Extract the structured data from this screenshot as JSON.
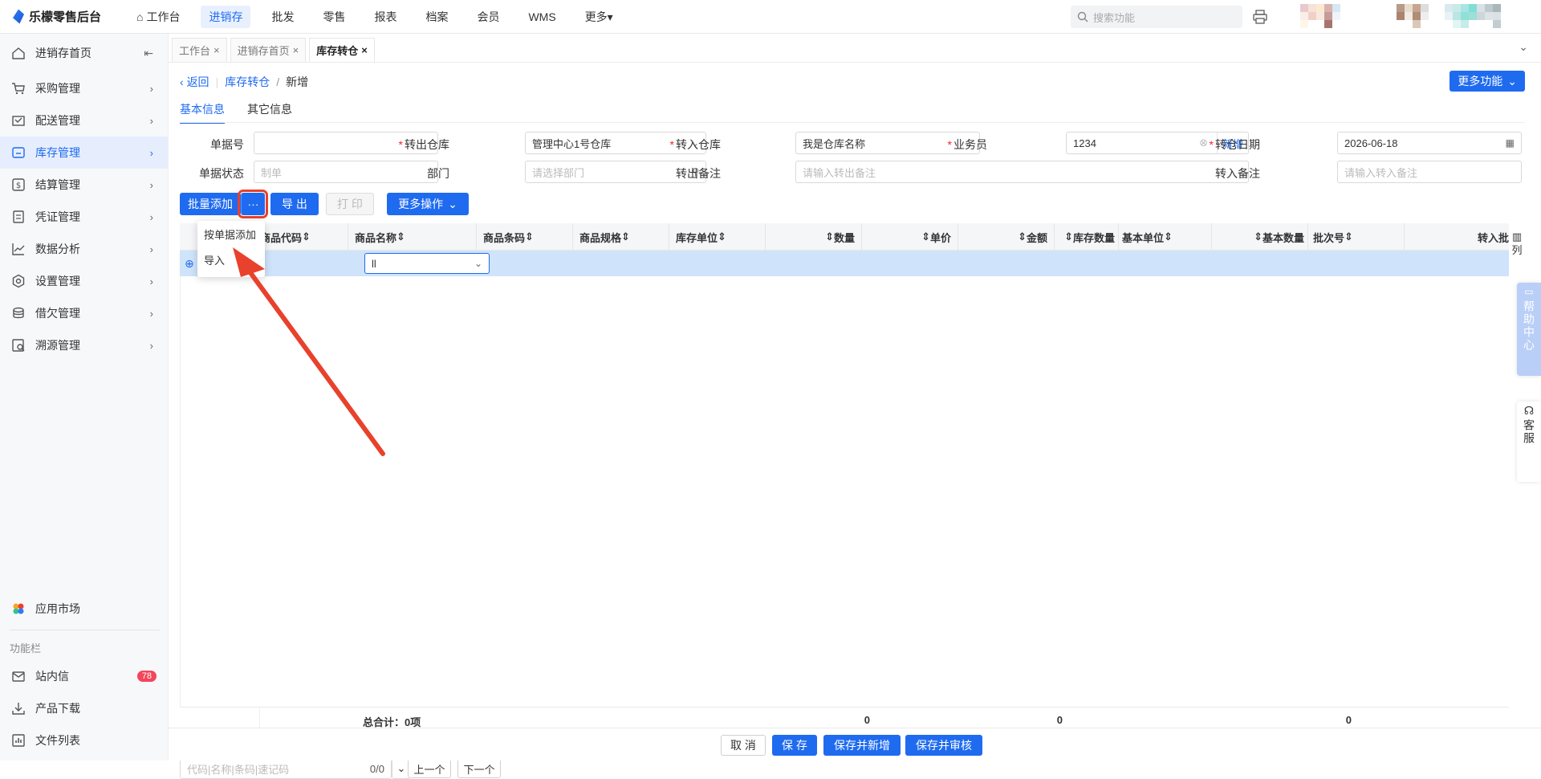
{
  "app": {
    "title": "乐檬零售后台"
  },
  "topnav": [
    {
      "label": "工作台",
      "icon": "home-icon"
    },
    {
      "label": "进销存",
      "active": true
    },
    {
      "label": "批发"
    },
    {
      "label": "零售"
    },
    {
      "label": "报表"
    },
    {
      "label": "档案"
    },
    {
      "label": "会员"
    },
    {
      "label": "WMS"
    },
    {
      "label": "更多▾"
    }
  ],
  "search": {
    "placeholder": "搜索功能"
  },
  "sidebar": {
    "items": [
      {
        "label": "进销存首页",
        "icon": "home-icon"
      },
      {
        "label": "采购管理",
        "icon": "cart-icon"
      },
      {
        "label": "配送管理",
        "icon": "truck-icon"
      },
      {
        "label": "库存管理",
        "icon": "inventory-icon",
        "active": true
      },
      {
        "label": "结算管理",
        "icon": "dollar-icon"
      },
      {
        "label": "凭证管理",
        "icon": "voucher-icon"
      },
      {
        "label": "数据分析",
        "icon": "chart-icon"
      },
      {
        "label": "设置管理",
        "icon": "settings-icon"
      },
      {
        "label": "借欠管理",
        "icon": "coins-icon"
      },
      {
        "label": "溯源管理",
        "icon": "trace-icon"
      }
    ],
    "market": "应用市场",
    "group_title": "功能栏",
    "footer": [
      {
        "label": "站内信",
        "badge": "78"
      },
      {
        "label": "产品下载"
      },
      {
        "label": "文件列表"
      }
    ]
  },
  "tabs": [
    {
      "label": "工作台"
    },
    {
      "label": "进销存首页"
    },
    {
      "label": "库存转仓",
      "active": true
    }
  ],
  "breadcrumb": {
    "back": "返回",
    "parent": "库存转仓",
    "sep": "/",
    "current": "新增"
  },
  "more_functions": "更多功能",
  "subtabs": [
    {
      "label": "基本信息",
      "active": true
    },
    {
      "label": "其它信息"
    }
  ],
  "form": {
    "doc_no": {
      "label": "单据号",
      "value": ""
    },
    "out_wh": {
      "label": "转出仓库",
      "value": "管理中心1号仓库"
    },
    "in_wh": {
      "label": "转入仓库",
      "value": "我是仓库名称"
    },
    "clerk": {
      "label": "业务员",
      "value": "1234",
      "link": "新增"
    },
    "date": {
      "label": "转仓日期",
      "value": "2026-06-18"
    },
    "status": {
      "label": "单据状态",
      "placeholder": "制单"
    },
    "dept": {
      "label": "部门",
      "placeholder": "请选择部门"
    },
    "out_note": {
      "label": "转出备注",
      "placeholder": "请输入转出备注"
    },
    "in_note": {
      "label": "转入备注",
      "placeholder": "请输入转入备注"
    }
  },
  "toolbar": {
    "batch_add": "批量添加",
    "more_dots": "···",
    "export": "导 出",
    "print": "打 印",
    "more_ops": "更多操作"
  },
  "dropdown": {
    "items": [
      "按单据添加",
      "导入"
    ]
  },
  "grid": {
    "columns": [
      "商品代码",
      "商品名称",
      "商品条码",
      "商品规格",
      "库存单位",
      "数量",
      "单价",
      "金额",
      "库存数量",
      "基本单位",
      "基本数量",
      "批次号",
      "转入批"
    ],
    "row_input": "ll",
    "col_setting": "列",
    "total_label": "总合计：0项",
    "totals": [
      "0",
      "0",
      "0"
    ]
  },
  "find": {
    "placeholder": "代码|名称|条码|速记码",
    "count": "0/0",
    "prev": "上一个",
    "next": "下一个"
  },
  "footer_buttons": {
    "cancel": "取 消",
    "save": "保 存",
    "save_new": "保存并新增",
    "save_audit": "保存并审核"
  },
  "side_float": {
    "help": "帮助中心",
    "service": "客服"
  },
  "colors": {
    "accent": "#1f6bf0",
    "badge": "#f5455c",
    "row_highlight": "#cfe3fb",
    "arrow": "#e8412c"
  }
}
